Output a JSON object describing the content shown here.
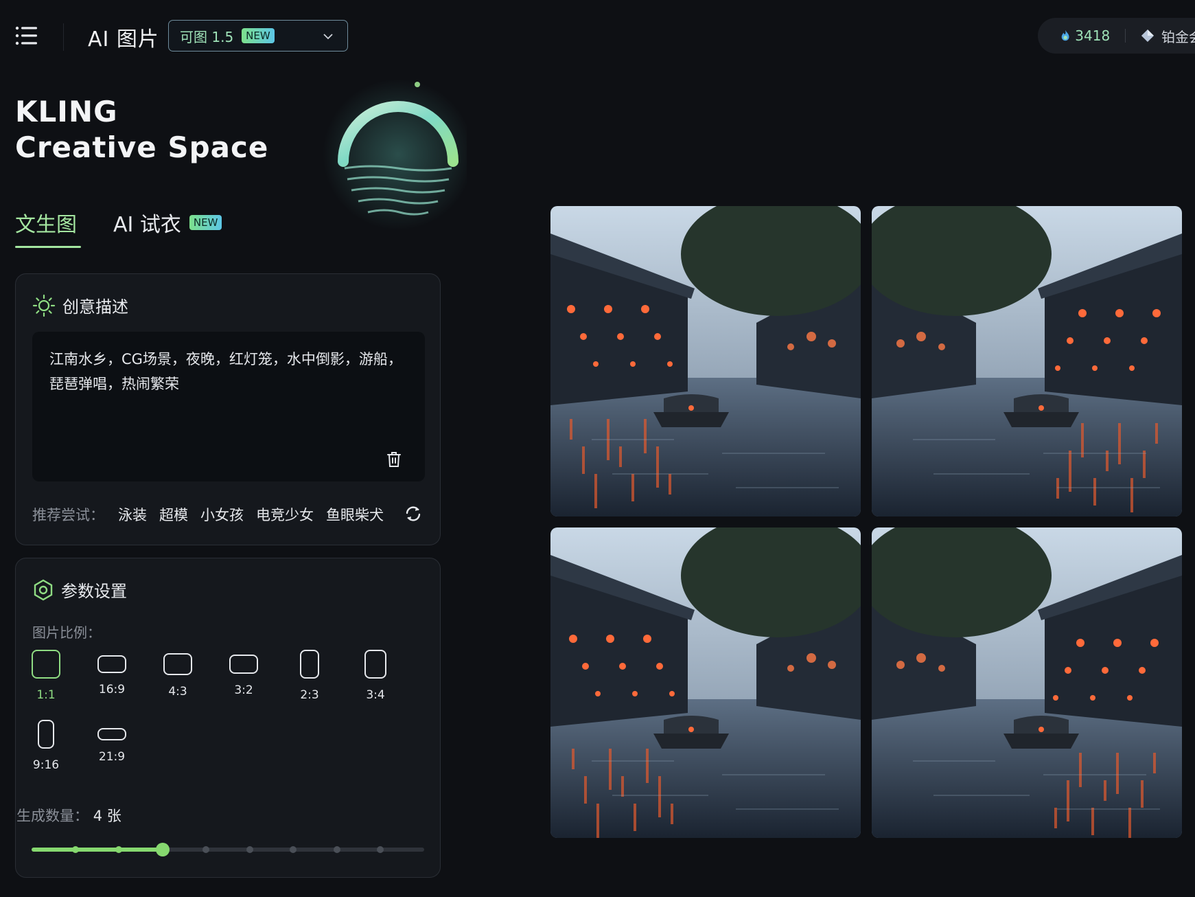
{
  "header": {
    "app_title": "AI 图片",
    "model": {
      "label": "可图 1.5",
      "badge": "NEW"
    },
    "points": "3418",
    "tier": "铂金会员"
  },
  "brand": {
    "line1": "KLING",
    "line2": "Creative Space"
  },
  "tabs": [
    {
      "label": "文生图",
      "active": true
    },
    {
      "label": "AI 试衣",
      "badge": "NEW",
      "active": false
    }
  ],
  "prompt_panel": {
    "title": "创意描述",
    "text_line1": "江南水乡，CG场景，夜晚，红灯笼，水中倒影，游船，",
    "text_line2": "琵琶弹唱，热闹繁荣",
    "recommend_label": "推荐尝试：",
    "recommend_items": [
      "泳装",
      "超模",
      "小女孩",
      "电竞少女",
      "鱼眼柴犬"
    ]
  },
  "params_panel": {
    "title": "参数设置",
    "ratio_label": "图片比例：",
    "ratios": [
      "1:1",
      "16:9",
      "4:3",
      "3:2",
      "2:3",
      "3:4",
      "9:16",
      "21:9"
    ],
    "selected_ratio": "1:1",
    "count_label": "生成数量：",
    "count_value": "4 张",
    "count_selected": 4,
    "count_max": 10
  },
  "colors": {
    "accent": "#8fdc83",
    "background": "#0e1014",
    "panel": "#15181d"
  },
  "icons": {
    "menu": "menu-icon",
    "chevron": "chevron-down-icon",
    "points": "flame-icon",
    "tier": "diamond-icon",
    "prompt": "sun-icon",
    "params": "hexagon-icon",
    "clear": "trash-icon",
    "refresh": "refresh-icon"
  },
  "gallery": {
    "count": 4,
    "alt": "江南水乡夜景"
  }
}
